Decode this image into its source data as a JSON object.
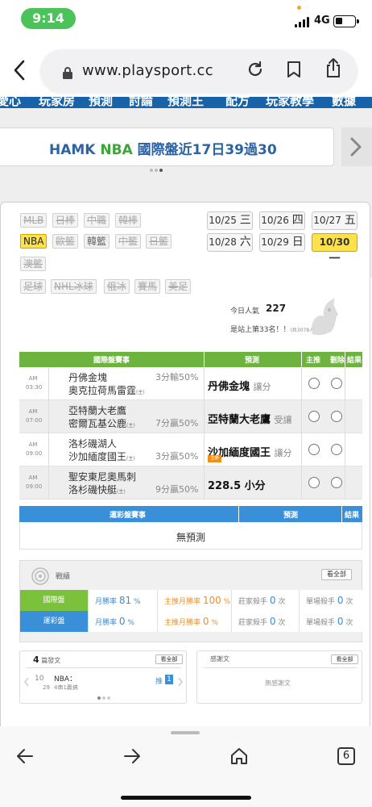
{
  "status_bar": {
    "time": "9:14",
    "network": "4G"
  },
  "browser": {
    "url": "www.playsport.cc",
    "tab_count": "6"
  },
  "site": {
    "nav_items": [
      "愛心",
      "玩家房",
      "預測",
      "討論",
      "預測王",
      "配方",
      "玩家教學",
      "數據"
    ],
    "banner": {
      "part1": "HAMK",
      "part2": "NBA",
      "part3": "國際盤近17日39過30"
    }
  },
  "sport_filters": [
    {
      "label": "MLB",
      "state": "disabled"
    },
    {
      "label": "日棒",
      "state": "disabled"
    },
    {
      "label": "中職",
      "state": "disabled"
    },
    {
      "label": "韓棒",
      "state": "disabled"
    },
    {
      "label": "NBA",
      "state": "active"
    },
    {
      "label": "歐籃",
      "state": "disabled"
    },
    {
      "label": "韓籃",
      "state": "plain"
    },
    {
      "label": "中籃",
      "state": "disabled"
    },
    {
      "label": "日籃",
      "state": "disabled"
    },
    {
      "label": "澳籃",
      "state": "disabled"
    },
    {
      "label": "足球",
      "state": "disabled"
    },
    {
      "label": "NHL冰球",
      "state": "disabled"
    },
    {
      "label": "俄冰",
      "state": "disabled"
    },
    {
      "label": "賽馬",
      "state": "disabled"
    },
    {
      "label": "美足",
      "state": "disabled"
    }
  ],
  "dates": [
    {
      "md": "10/25",
      "dow": "三",
      "selected": false
    },
    {
      "md": "10/26",
      "dow": "四",
      "selected": false
    },
    {
      "md": "10/27",
      "dow": "五",
      "selected": false
    },
    {
      "md": "10/28",
      "dow": "六",
      "selected": false
    },
    {
      "md": "10/29",
      "dow": "日",
      "selected": false
    },
    {
      "md": "10/30",
      "dow": "一",
      "selected": true
    }
  ],
  "popularity": {
    "label": "今日人氣",
    "value": "227",
    "rank_text": "是站上第33名！！",
    "rank_small": "(共3078人)"
  },
  "intl_table": {
    "headers": {
      "event": "國際盤賽事",
      "pick": "預測",
      "main": "主推",
      "delete": "刪除",
      "result": "結果"
    },
    "rows": [
      {
        "ampm": "AM",
        "time": "03:30",
        "team1": "丹佛金塊",
        "team2": "奧克拉荷馬雷霆",
        "home_mark": "(主)",
        "line": "3分輸50%",
        "line_row": 1,
        "pick": "丹佛金塊",
        "pick_sub": "讓分",
        "badge": ""
      },
      {
        "ampm": "AM",
        "time": "07:00",
        "team1": "亞特蘭大老鷹",
        "team2": "密爾瓦基公鹿",
        "home_mark": "(主)",
        "line": "7分贏50%",
        "line_row": 2,
        "pick": "亞特蘭大老鷹",
        "pick_sub": "受讓",
        "badge": ""
      },
      {
        "ampm": "AM",
        "time": "09:00",
        "team1": "洛杉磯湖人",
        "team2": "沙加緬度國王",
        "home_mark": "(主)",
        "line": "3分贏50%",
        "line_row": 2,
        "pick": "沙加緬度國王",
        "pick_sub": "讓分",
        "badge": "主推"
      },
      {
        "ampm": "AM",
        "time": "09:00",
        "team1": "聖安東尼奧馬刺",
        "team2": "洛杉磯快艇",
        "home_mark": "(主)",
        "line": "9分贏50%",
        "line_row": 2,
        "pick": "228.5 小分",
        "pick_sub": "",
        "badge": ""
      }
    ]
  },
  "lottery_table": {
    "headers": {
      "event": "運彩盤賽事",
      "pick": "預測",
      "result": "結果"
    },
    "empty_text": "無預測"
  },
  "record": {
    "title": "戰績",
    "view_all": "看全部",
    "rows": [
      {
        "tag": "國際盤",
        "color": "#7cc13c",
        "win_label": "月勝率",
        "win_value": "81",
        "main_label": "主推月勝率",
        "main_value": "100",
        "streak_label": "莊家殺手",
        "streak_value": "0",
        "streak_unit": "次",
        "single_label": "單場殺手",
        "single_value": "0",
        "single_unit": "次"
      },
      {
        "tag": "運彩盤",
        "color": "#3a8fd9",
        "win_label": "月勝率",
        "win_value": "0",
        "main_label": "主推月勝率",
        "main_value": "0",
        "streak_label": "莊家殺手",
        "streak_value": "0",
        "streak_unit": "次",
        "single_label": "單場殺手",
        "single_value": "0",
        "single_unit": "次"
      }
    ],
    "pct": "%"
  },
  "posts_box": {
    "count": "4",
    "title": "篇發文",
    "view_all": "看全部",
    "date_top": "10",
    "date_bottom": "29",
    "post_title": "NBA：",
    "post_sub": "4串1贏搞",
    "push_label": "推",
    "push_count": "1"
  },
  "thanks_box": {
    "title": "感謝文",
    "view_all": "看全部",
    "empty_text": "無感謝文"
  },
  "colors": {
    "green": "#6db33f",
    "blue": "#3a8fd9",
    "yellow": "#ffe24a",
    "nav_blue": "#1762a8"
  },
  "icons": [
    "back-chevron-icon",
    "lock-icon",
    "reload-icon",
    "bookmark-icon",
    "share-icon",
    "forward-arrow-icon",
    "home-icon",
    "tabs-icon",
    "target-icon",
    "mascot-icon"
  ]
}
